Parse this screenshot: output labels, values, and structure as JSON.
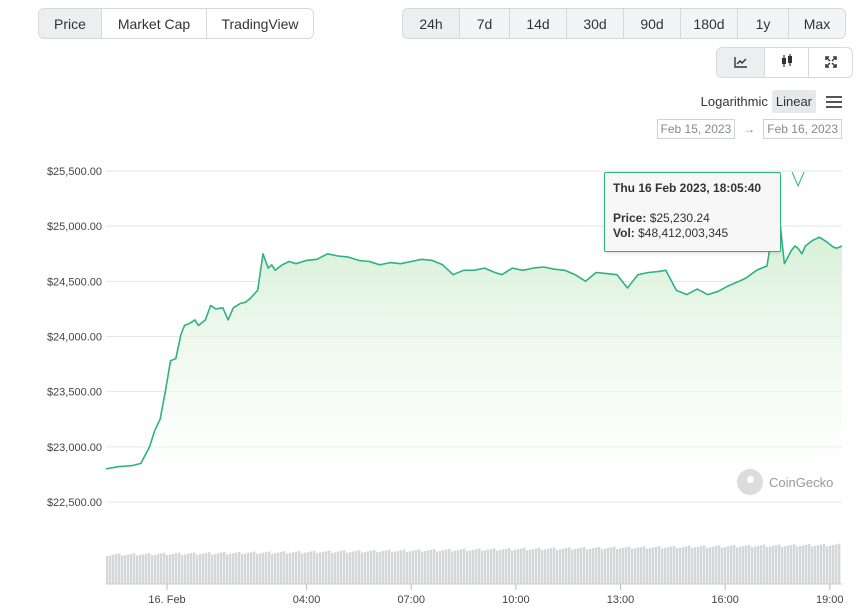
{
  "type_tabs": {
    "items": [
      {
        "label": "Price",
        "active": true
      },
      {
        "label": "Market Cap",
        "active": false
      },
      {
        "label": "TradingView",
        "active": false
      }
    ]
  },
  "range_tabs": {
    "items": [
      {
        "label": "24h",
        "active": true
      },
      {
        "label": "7d",
        "active": false
      },
      {
        "label": "14d",
        "active": false
      },
      {
        "label": "30d",
        "active": false
      },
      {
        "label": "90d",
        "active": false
      },
      {
        "label": "180d",
        "active": false
      },
      {
        "label": "1y",
        "active": false
      },
      {
        "label": "Max",
        "active": false
      }
    ]
  },
  "view_tabs": {
    "items": [
      {
        "icon": "line-chart-icon",
        "active": true
      },
      {
        "icon": "candlestick-icon",
        "active": false
      },
      {
        "icon": "fullscreen-icon",
        "active": false
      }
    ]
  },
  "scale": {
    "logarithmic_label": "Logarithmic",
    "linear_label": "Linear",
    "active": "Linear",
    "menu_icon": "hamburger-menu-icon"
  },
  "date_range": {
    "from": "Feb 15, 2023",
    "arrow": "→",
    "to": "Feb 16, 2023"
  },
  "tooltip": {
    "title": "Thu 16 Feb 2023, 18:05:40",
    "price_label": "Price:",
    "price_value": "$25,230.24",
    "vol_label": "Vol:",
    "vol_value": "$48,412,003,345"
  },
  "watermark": {
    "text": "CoinGecko",
    "icon": "coingecko-logo-icon"
  },
  "colors": {
    "line": "#2fb27f",
    "fill_top": "#cdeccd",
    "grid": "#e6e6e6",
    "volume": "#d4d6d8"
  },
  "chart_data": {
    "type": "area",
    "title": "",
    "xlabel": "",
    "ylabel": "",
    "ylim": [
      22500,
      25500
    ],
    "y_ticks": [
      "$22,500.00",
      "$23,000.00",
      "$23,500.00",
      "$24,000.00",
      "$24,500.00",
      "$25,000.00",
      "$25,500.00"
    ],
    "y_tick_values": [
      22500,
      23000,
      23500,
      24000,
      24500,
      25000,
      25500
    ],
    "x_range_hours": [
      -1.75,
      19.35
    ],
    "x_ticks": [
      {
        "label": "16. Feb",
        "hour": 0
      },
      {
        "label": "04:00",
        "hour": 4
      },
      {
        "label": "07:00",
        "hour": 7
      },
      {
        "label": "10:00",
        "hour": 10
      },
      {
        "label": "13:00",
        "hour": 13
      },
      {
        "label": "16:00",
        "hour": 16
      },
      {
        "label": "19:00",
        "hour": 19
      }
    ],
    "grid": true,
    "series": [
      {
        "x": [
          -1.75,
          -1.4,
          -1.0,
          -0.75,
          -0.5,
          -0.35,
          -0.2,
          -0.05,
          0.1,
          0.25,
          0.4,
          0.5,
          0.65,
          0.8,
          0.9,
          1.1,
          1.25,
          1.4,
          1.6,
          1.75,
          1.9,
          2.1,
          2.25,
          2.4,
          2.6,
          2.75,
          2.9,
          3.0,
          3.1,
          3.3,
          3.5,
          3.7,
          4.0,
          4.3,
          4.6,
          4.9,
          5.2,
          5.5,
          5.8,
          6.1,
          6.4,
          6.7,
          7.0,
          7.3,
          7.6,
          7.9,
          8.2,
          8.5,
          8.8,
          9.1,
          9.4,
          9.6,
          9.9,
          10.2,
          10.5,
          10.8,
          11.1,
          11.4,
          11.7,
          12.0,
          12.3,
          12.6,
          12.9,
          13.2,
          13.5,
          13.8,
          14.1,
          14.3,
          14.6,
          14.9,
          15.2,
          15.5,
          15.8,
          16.1,
          16.4,
          16.6,
          16.9,
          17.2,
          17.5,
          17.7,
          17.9,
          18.0,
          18.09,
          18.2,
          18.3,
          18.5,
          18.7,
          18.9,
          19.1,
          19.2,
          19.35
        ],
        "y": [
          22800,
          22820,
          22830,
          22850,
          23000,
          23150,
          23250,
          23500,
          23780,
          23800,
          24020,
          24100,
          24120,
          24150,
          24100,
          24150,
          24280,
          24250,
          24260,
          24150,
          24260,
          24300,
          24310,
          24350,
          24420,
          24750,
          24620,
          24650,
          24600,
          24650,
          24680,
          24660,
          24690,
          24700,
          24750,
          24730,
          24720,
          24690,
          24680,
          24650,
          24670,
          24660,
          24680,
          24700,
          24690,
          24650,
          24560,
          24600,
          24600,
          24620,
          24580,
          24560,
          24620,
          24600,
          24620,
          24630,
          24610,
          24600,
          24560,
          24500,
          24580,
          24570,
          24560,
          24440,
          24560,
          24580,
          24590,
          24600,
          24420,
          24380,
          24430,
          24380,
          24410,
          24460,
          24500,
          24530,
          24600,
          24640,
          25230,
          24660,
          24780,
          24820,
          24800,
          24750,
          24820,
          24870,
          24900,
          24860,
          24810,
          24800,
          24820
        ]
      }
    ]
  }
}
